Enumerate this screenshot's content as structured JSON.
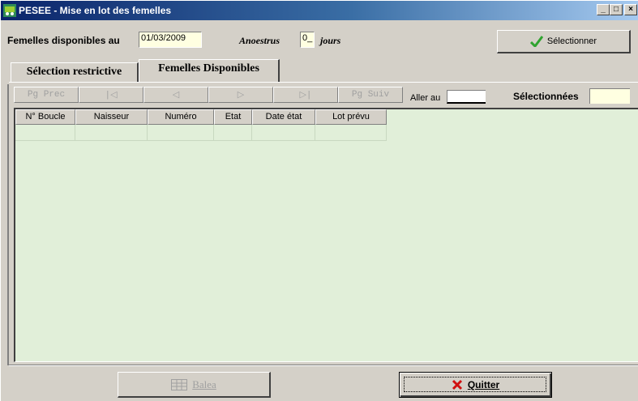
{
  "window": {
    "title": "PESEE - Mise en lot des femelles",
    "controls": [
      "minimize-icon",
      "maximize-icon",
      "close-icon"
    ]
  },
  "header": {
    "available_label": "Femelles disponibles au",
    "date_value": "01/03/2009",
    "anoestrus_label": "Anoestrus",
    "anoestrus_value": "0_",
    "days_label": "jours",
    "select_button": "Sélectionner"
  },
  "tabs": [
    {
      "label": "Sélection restrictive",
      "active": false
    },
    {
      "label": "Femelles Disponibles",
      "active": true
    }
  ],
  "navigation": {
    "prev_page": "Pg Prec",
    "first": "|◁",
    "prev": "◁",
    "next": "▷",
    "last": "▷|",
    "next_page": "Pg Suiv",
    "goto_label": "Aller au",
    "selected_label": "Sélectionnées",
    "selected_value": ""
  },
  "table": {
    "columns": [
      "N° Boucle",
      "Naisseur",
      "Numéro",
      "Etat",
      "Date état",
      "Lot prévu"
    ],
    "rows": []
  },
  "footer": {
    "balea_button": "Balea",
    "quit_button": "Quitter"
  },
  "colors": {
    "titlebar": "#0a246a",
    "grid_background": "#e1efd9",
    "field_background": "#ffffe1",
    "check_green": "#2fa32f",
    "cross_red": "#d01010"
  }
}
